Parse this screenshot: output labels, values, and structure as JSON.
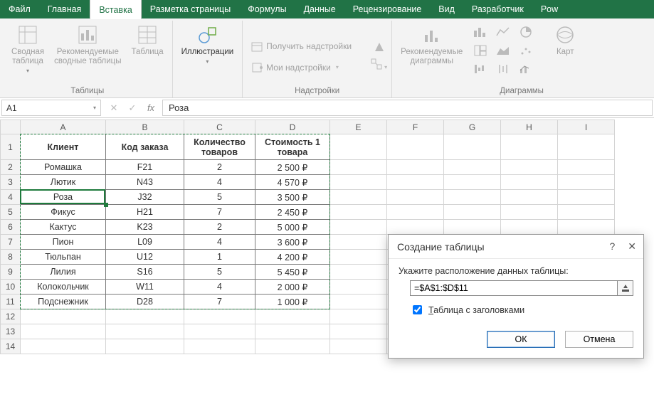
{
  "menu": {
    "tabs": [
      "Файл",
      "Главная",
      "Вставка",
      "Разметка страницы",
      "Формулы",
      "Данные",
      "Рецензирование",
      "Вид",
      "Разработчик",
      "Pow"
    ],
    "active_index": 2
  },
  "ribbon": {
    "groups": {
      "tables": {
        "caption": "Таблицы",
        "pivot": "Сводная\nтаблица",
        "recommended_pivot": "Рекомендуемые\nсводные таблицы",
        "table": "Таблица"
      },
      "illustrations": {
        "caption": "",
        "btn": "Иллюстрации"
      },
      "addins": {
        "caption": "Надстройки",
        "get": "Получить надстройки",
        "my": "Мои надстройки"
      },
      "charts": {
        "caption": "Диаграммы",
        "recommended": "Рекомендуемые\nдиаграммы",
        "maps": "Карт"
      }
    }
  },
  "formula_bar": {
    "name_box": "A1",
    "formula": "Роза"
  },
  "columns": [
    "A",
    "B",
    "C",
    "D",
    "E",
    "F",
    "G",
    "H",
    "I"
  ],
  "row_numbers": [
    1,
    2,
    3,
    4,
    5,
    6,
    7,
    8,
    9,
    10,
    11,
    12,
    13,
    14
  ],
  "headers": [
    "Клиент",
    "Код заказа",
    "Количество\nтоваров",
    "Стоимость 1\nтовара"
  ],
  "rows": [
    {
      "client": "Ромашка",
      "code": "F21",
      "qty": "2",
      "price": "2 500 ₽"
    },
    {
      "client": "Лютик",
      "code": "N43",
      "qty": "4",
      "price": "4 570 ₽"
    },
    {
      "client": "Роза",
      "code": "J32",
      "qty": "5",
      "price": "3 500 ₽"
    },
    {
      "client": "Фикус",
      "code": "H21",
      "qty": "7",
      "price": "2 450 ₽"
    },
    {
      "client": "Кактус",
      "code": "K23",
      "qty": "2",
      "price": "5 000 ₽"
    },
    {
      "client": "Пион",
      "code": "L09",
      "qty": "4",
      "price": "3 600 ₽"
    },
    {
      "client": "Тюльпан",
      "code": "U12",
      "qty": "1",
      "price": "4 200 ₽"
    },
    {
      "client": "Лилия",
      "code": "S16",
      "qty": "5",
      "price": "5 450 ₽"
    },
    {
      "client": "Колокольчик",
      "code": "W11",
      "qty": "4",
      "price": "2 000 ₽"
    },
    {
      "client": "Подснежник",
      "code": "D28",
      "qty": "7",
      "price": "1 000 ₽"
    }
  ],
  "dialog": {
    "title": "Создание таблицы",
    "prompt": "Укажите расположение данных таблицы:",
    "range": "=$A$1:$D$11",
    "checkbox": "Таблица с заголовками",
    "checkbox_checked": true,
    "ok": "ОК",
    "cancel": "Отмена"
  },
  "chart_data": {
    "type": "table",
    "columns": [
      "Клиент",
      "Код заказа",
      "Количество товаров",
      "Стоимость 1 товара (₽)"
    ],
    "rows": [
      [
        "Ромашка",
        "F21",
        2,
        2500
      ],
      [
        "Лютик",
        "N43",
        4,
        4570
      ],
      [
        "Роза",
        "J32",
        5,
        3500
      ],
      [
        "Фикус",
        "H21",
        7,
        2450
      ],
      [
        "Кактус",
        "K23",
        2,
        5000
      ],
      [
        "Пион",
        "L09",
        4,
        3600
      ],
      [
        "Тюльпан",
        "U12",
        1,
        4200
      ],
      [
        "Лилия",
        "S16",
        5,
        5450
      ],
      [
        "Колокольчик",
        "W11",
        4,
        2000
      ],
      [
        "Подснежник",
        "D28",
        7,
        1000
      ]
    ]
  }
}
